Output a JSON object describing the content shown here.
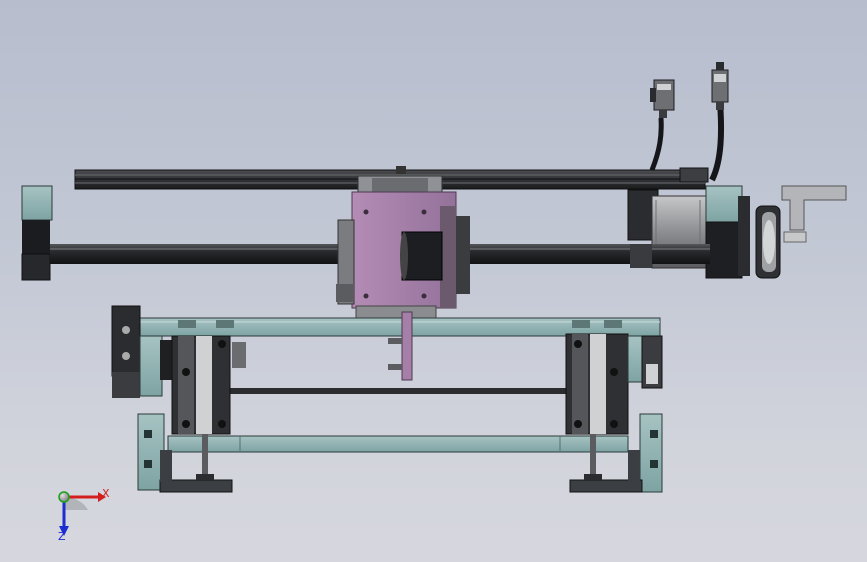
{
  "viewport": {
    "background_top": "#b7bdcd",
    "background_bottom": "#d6d7de"
  },
  "model": {
    "description_colors": {
      "frame_teal": "#8fb0b0",
      "frame_dark": "#3b3e42",
      "carriage_purple": "#a57fa7",
      "shaft_black": "#1f1f22",
      "rail_black": "#2a2b2e",
      "motor_gray": "#9a9c9f",
      "motor_black": "#222326"
    }
  },
  "triad": {
    "x_label": "X",
    "z_label": "Z",
    "x_color": "#d21e1e",
    "y_color": "#1aa01a",
    "z_color": "#1c2ed0"
  }
}
